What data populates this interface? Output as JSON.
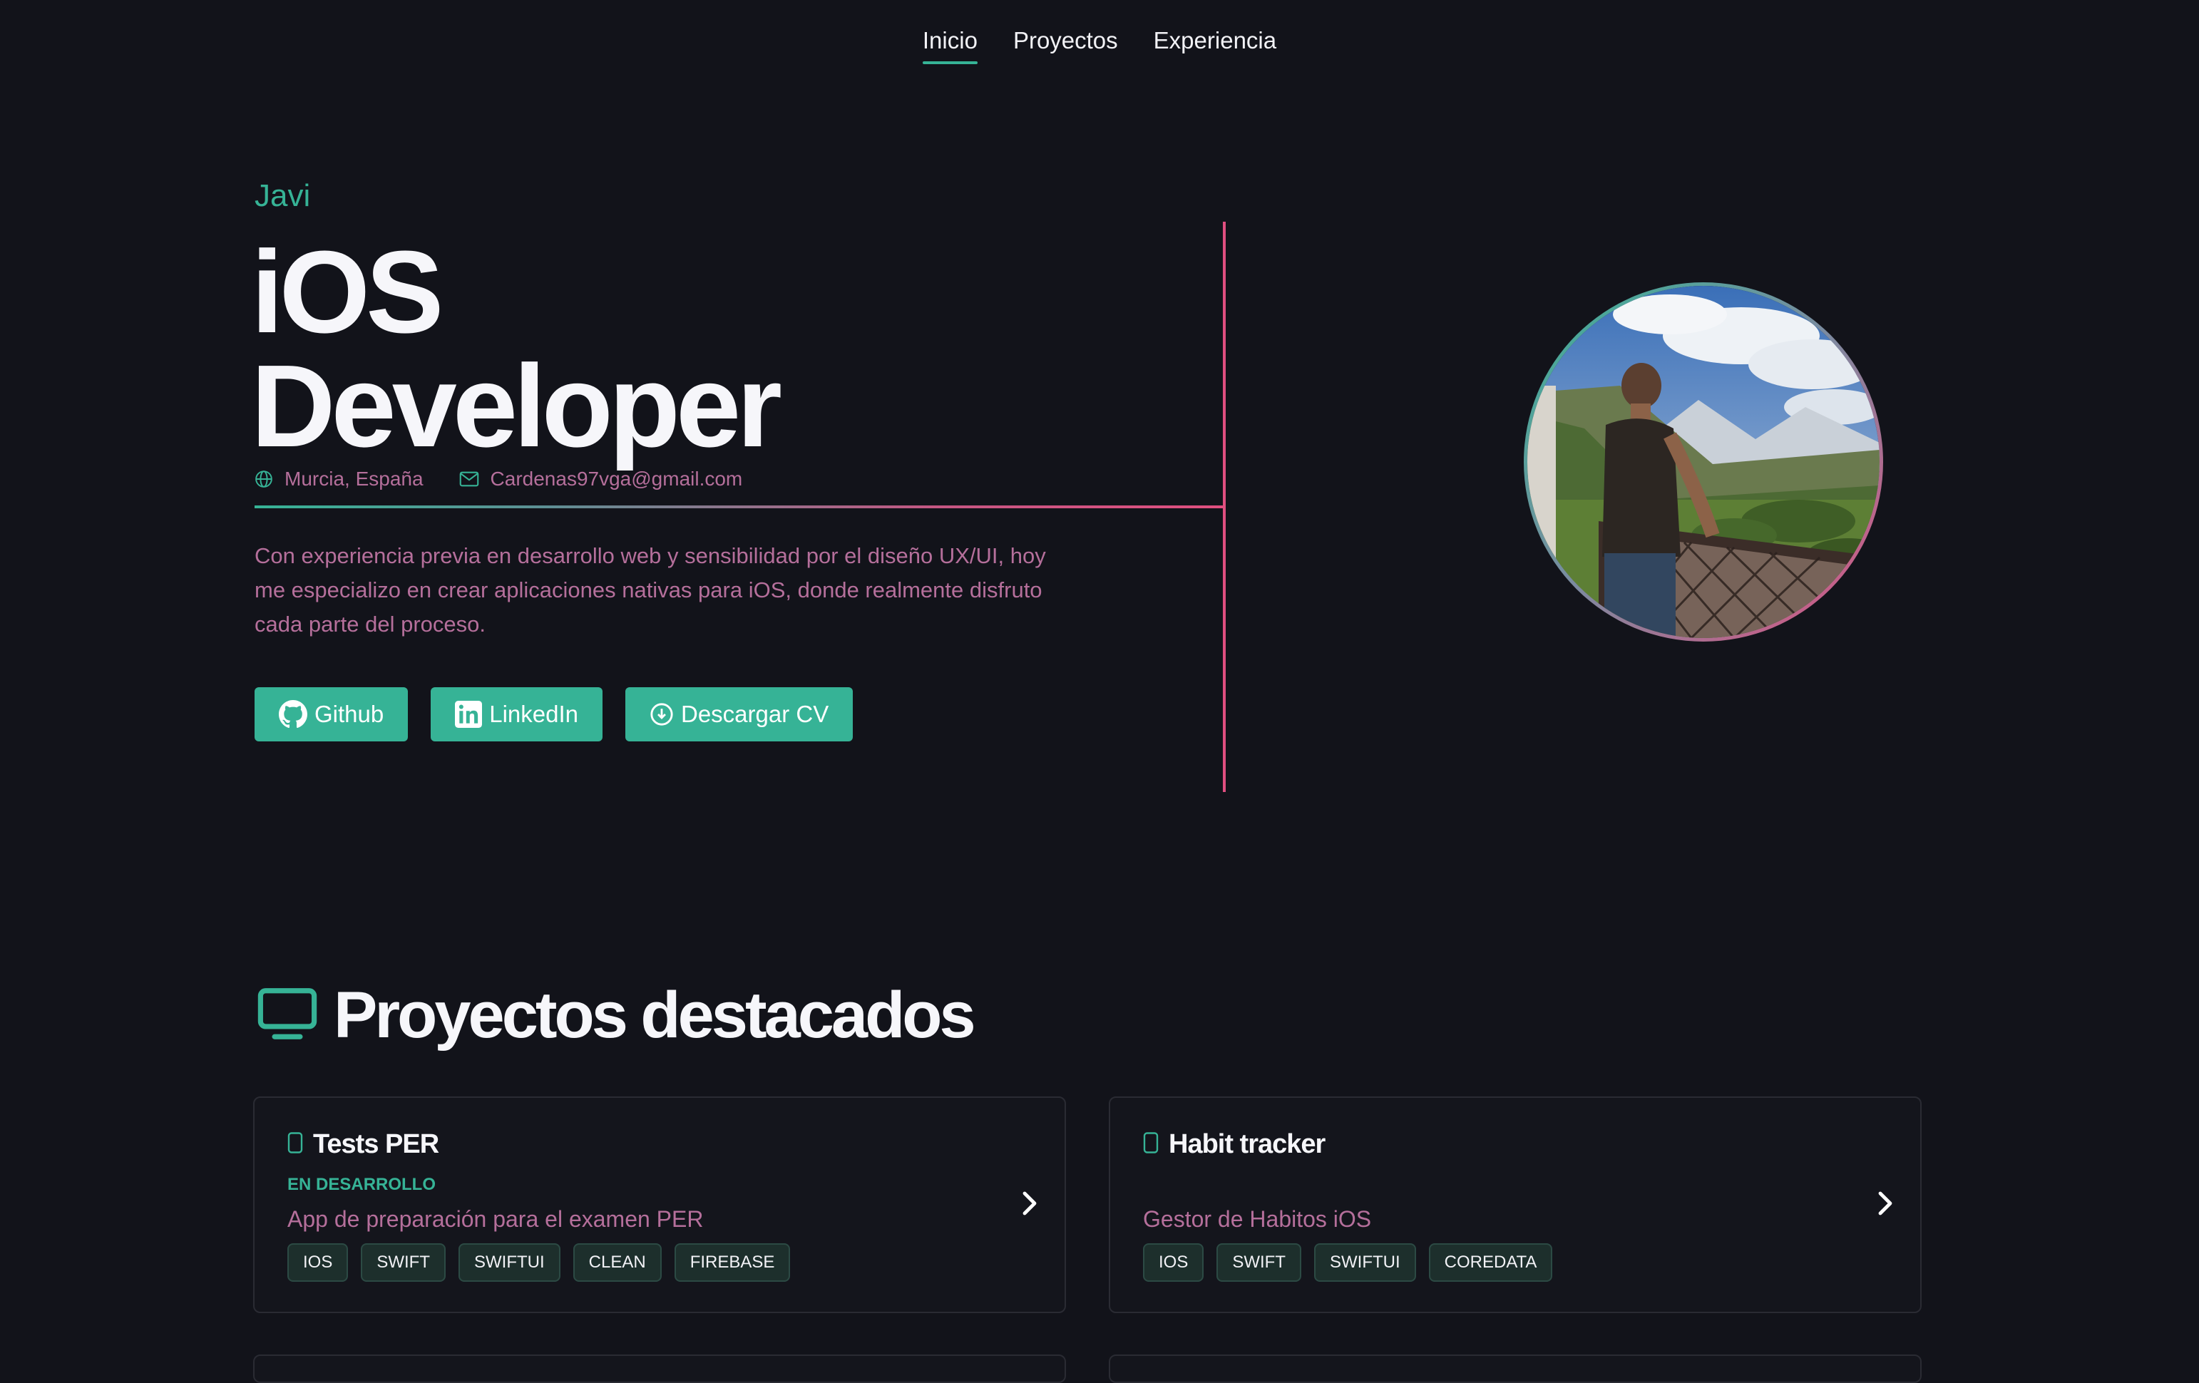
{
  "nav": {
    "items": [
      "Inicio",
      "Proyectos",
      "Experiencia"
    ],
    "active": "Inicio"
  },
  "hero": {
    "name": "Javi",
    "title_line1": "iOS",
    "title_line2": "Developer",
    "location": "Murcia, España",
    "email": "Cardenas97vga@gmail.com",
    "description": "Con experiencia previa en desarrollo web y sensibilidad por el diseño UX/UI, hoy me especializo en crear aplicaciones nativas para iOS, donde realmente disfruto cada parte del proceso.",
    "buttons": {
      "github": "Github",
      "linkedin": "LinkedIn",
      "cv": "Descargar CV"
    }
  },
  "projects": {
    "title": "Proyectos destacados",
    "items": [
      {
        "name": "Tests PER",
        "status": "EN DESARROLLO",
        "description": "App de preparación para el examen PER",
        "tags": [
          "IOS",
          "SWIFT",
          "SWIFTUI",
          "CLEAN",
          "FIREBASE"
        ]
      },
      {
        "name": "Habit tracker",
        "status": "",
        "description": "Gestor de Habitos iOS",
        "tags": [
          "IOS",
          "SWIFT",
          "SWIFTUI",
          "COREDATA"
        ]
      }
    ]
  },
  "colors": {
    "background": "#12131a",
    "accent": "#36b396",
    "pink": "#e04f80",
    "muted_pink_text": "#b56f9b"
  },
  "icons": {
    "location": "globe-icon",
    "email": "mail-icon",
    "github": "github-icon",
    "linkedin": "linkedin-icon",
    "cv": "download-icon",
    "section": "monitor-icon",
    "card": "smartphone-icon",
    "card_action": "chevron-right-icon"
  }
}
